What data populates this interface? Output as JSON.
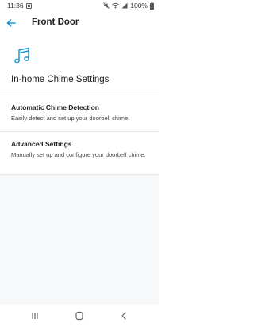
{
  "status_bar": {
    "time": "11:36",
    "battery": "100%",
    "icons": [
      "notification-icon",
      "mute-icon",
      "wifi-icon",
      "signal-icon",
      "battery-icon"
    ]
  },
  "app_bar": {
    "title": "Front Door",
    "back_icon": "back-arrow-icon",
    "accent_color": "#1998d5"
  },
  "section": {
    "icon": "music-note-icon",
    "title": "In-home Chime Settings"
  },
  "items": [
    {
      "title": "Automatic Chime Detection",
      "description": "Easily detect and set up your doorbell chime."
    },
    {
      "title": "Advanced Settings",
      "description": "Manually set up and configure your doorbell chime."
    }
  ],
  "nav_bar": {
    "icons": [
      "recents-icon",
      "home-icon",
      "back-icon"
    ]
  }
}
